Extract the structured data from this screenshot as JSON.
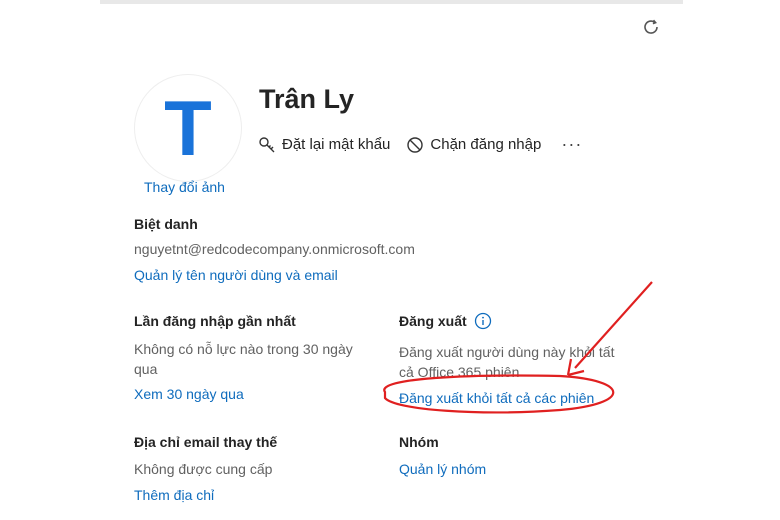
{
  "profile": {
    "avatar_letter": "T",
    "change_photo": "Thay đổi ảnh",
    "name": "Trân Ly"
  },
  "actions": {
    "reset_password": "Đặt lại mật khẩu",
    "block_signin": "Chặn đăng nhập",
    "more": "···"
  },
  "alias": {
    "label": "Biệt danh",
    "value": "nguyetnt@redcodecompany.onmicrosoft.com",
    "link": "Quản lý tên người dùng và email"
  },
  "last_signin": {
    "label": "Lần đăng nhập gần nhất",
    "value_line1": "Không có nỗ lực nào trong 30 ngày",
    "value_line2": "qua",
    "link": "Xem 30 ngày qua"
  },
  "signout": {
    "label": "Đăng xuất",
    "desc_line1": "Đăng xuất người dùng này khỏi tất",
    "desc_line2": "cả Office 365 phiên",
    "link": "Đăng xuất khỏi tất cả các phiên"
  },
  "alt_email": {
    "label": "Địa chỉ email thay thế",
    "value": "Không được cung cấp",
    "link": "Thêm địa chỉ"
  },
  "groups": {
    "label": "Nhóm",
    "link": "Quản lý nhóm"
  },
  "colors": {
    "link": "#0f6cbd",
    "avatar": "#1a73d9",
    "annotation": "#e02020"
  }
}
